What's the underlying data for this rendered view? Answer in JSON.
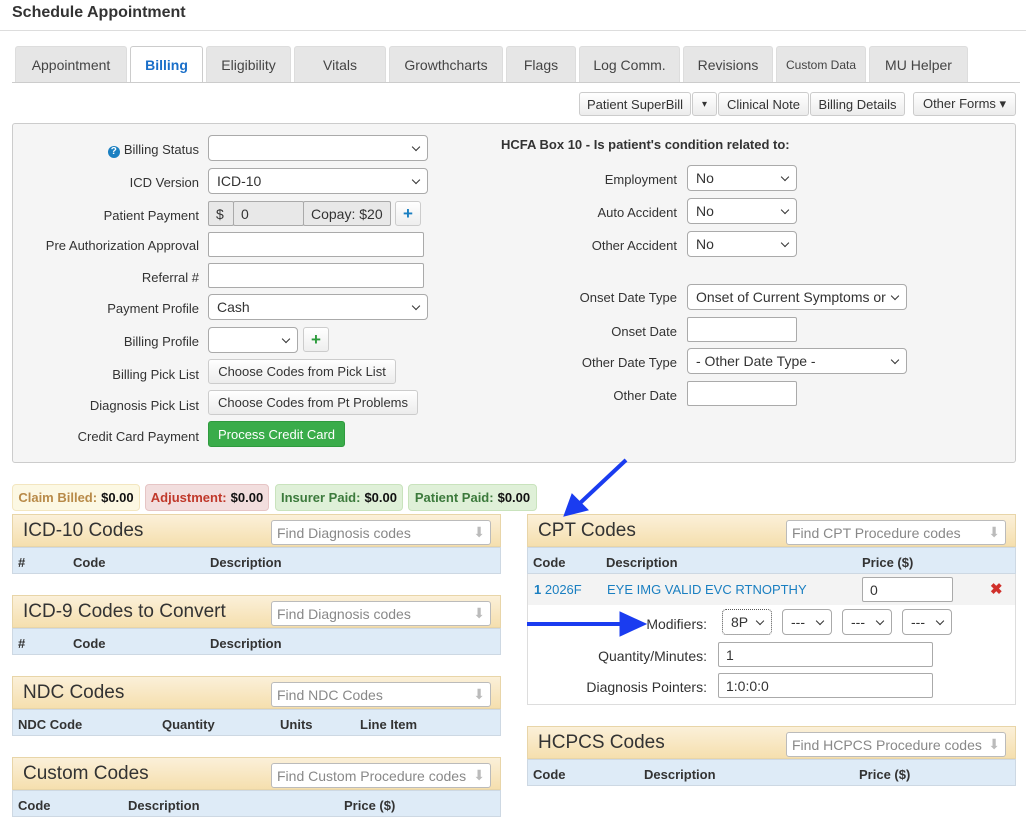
{
  "title": "Schedule Appointment",
  "tabs": [
    "Appointment",
    "Billing",
    "Eligibility",
    "Vitals",
    "Growthcharts",
    "Flags",
    "Log Comm.",
    "Revisions",
    "Custom Data",
    "MU Helper"
  ],
  "active_tab": "Billing",
  "toolbar": {
    "superbill": "Patient SuperBill",
    "caret": "▾",
    "clinical_note": "Clinical Note",
    "billing_details": "Billing Details",
    "other_forms": "Other Forms ▾"
  },
  "left_form": {
    "billing_status": {
      "label": "Billing Status",
      "value": ""
    },
    "icd_version": {
      "label": "ICD Version",
      "value": "ICD-10"
    },
    "patient_payment": {
      "label": "Patient Payment",
      "currency": "$",
      "value": "0",
      "copay": "Copay: $20"
    },
    "pre_auth": {
      "label": "Pre Authorization Approval",
      "value": ""
    },
    "referral": {
      "label": "Referral #",
      "value": ""
    },
    "payment_profile": {
      "label": "Payment Profile",
      "value": "Cash"
    },
    "billing_profile": {
      "label": "Billing Profile",
      "value": ""
    },
    "billing_pick_list": {
      "label": "Billing Pick List",
      "button": "Choose Codes from Pick List"
    },
    "diagnosis_pick_list": {
      "label": "Diagnosis Pick List",
      "button": "Choose Codes from Pt Problems"
    },
    "credit_card": {
      "label": "Credit Card Payment",
      "button": "Process Credit Card"
    }
  },
  "hcfa": {
    "heading": "HCFA Box 10 - Is patient's condition related to:",
    "employment": {
      "label": "Employment",
      "value": "No"
    },
    "auto_accident": {
      "label": "Auto Accident",
      "value": "No"
    },
    "other_accident": {
      "label": "Other Accident",
      "value": "No"
    },
    "onset_date_type": {
      "label": "Onset Date Type",
      "value": "Onset of Current Symptoms or"
    },
    "onset_date": {
      "label": "Onset Date",
      "value": ""
    },
    "other_date_type": {
      "label": "Other Date Type",
      "value": "- Other Date Type -"
    },
    "other_date": {
      "label": "Other Date",
      "value": ""
    }
  },
  "badges": {
    "claim_billed": {
      "label": "Claim Billed:",
      "value": "$0.00"
    },
    "adjustment": {
      "label": "Adjustment:",
      "value": "$0.00"
    },
    "insurer_paid": {
      "label": "Insurer Paid:",
      "value": "$0.00"
    },
    "patient_paid": {
      "label": "Patient Paid:",
      "value": "$0.00"
    }
  },
  "icd10": {
    "title": "ICD-10 Codes",
    "placeholder": "Find Diagnosis codes",
    "cols": [
      "#",
      "Code",
      "Description"
    ]
  },
  "icd9": {
    "title": "ICD-9 Codes to Convert",
    "placeholder": "Find Diagnosis codes",
    "cols": [
      "#",
      "Code",
      "Description"
    ]
  },
  "ndc": {
    "title": "NDC Codes",
    "placeholder": "Find NDC Codes",
    "cols": [
      "NDC Code",
      "Quantity",
      "Units",
      "Line Item"
    ]
  },
  "custom": {
    "title": "Custom Codes",
    "placeholder": "Find Custom Procedure codes",
    "cols": [
      "Code",
      "Description",
      "Price ($)"
    ]
  },
  "cpt": {
    "title": "CPT Codes",
    "placeholder": "Find CPT Procedure codes",
    "cols": [
      "Code",
      "Description",
      "Price ($)"
    ],
    "row": {
      "num": "1",
      "code": "2026F",
      "description": "EYE IMG VALID EVC RTNOPTHY",
      "price": "0"
    },
    "modifiers_label": "Modifiers:",
    "modifiers": [
      "8P",
      "---",
      "---",
      "---"
    ],
    "quantity_label": "Quantity/Minutes:",
    "quantity": "1",
    "pointers_label": "Diagnosis Pointers:",
    "pointers": "1:0:0:0"
  },
  "hcpcs": {
    "title": "HCPCS Codes",
    "placeholder": "Find HCPCS Procedure codes",
    "cols": [
      "Code",
      "Description",
      "Price ($)"
    ]
  },
  "colors": {
    "tab_active": "#1a6fc9",
    "link": "#1a7fc1",
    "arrow": "#1a3cf0",
    "green": "#3aac4a"
  }
}
